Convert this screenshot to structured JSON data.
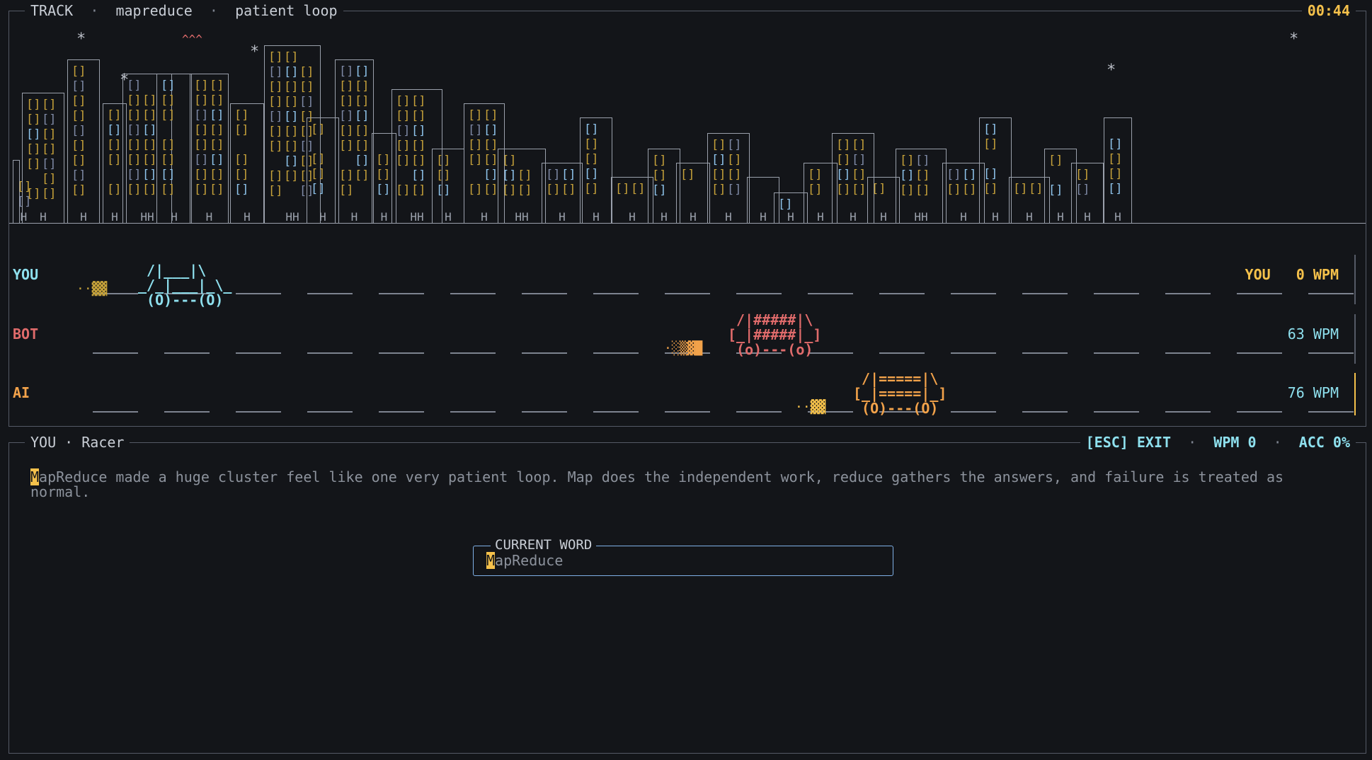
{
  "header": {
    "segments": [
      "TRACK",
      "mapreduce",
      "patient loop"
    ],
    "separator": "·",
    "timer": "00:44"
  },
  "lanes": [
    {
      "name": "YOU",
      "wpm_label": "YOU   0 WPM",
      "color": "#8ee0ee",
      "progress": 0.02
    },
    {
      "name": "BOT",
      "wpm_label": "63 WPM",
      "color": "#e06b6b",
      "progress": 0.45
    },
    {
      "name": "AI",
      "wpm_label": "76 WPM",
      "color": "#f2a24a",
      "progress": 0.54
    }
  ],
  "panel": {
    "title": "YOU · Racer",
    "controls": {
      "exit": "[ESC] EXIT",
      "wpm": "WPM 0",
      "acc": "ACC 0%"
    }
  },
  "passage": {
    "cursor_char": "M",
    "rest": "apReduce made a huge cluster feel like one very patient loop. Map does the independent work, reduce gathers the answers, and failure is treated as normal."
  },
  "current_word": {
    "label": "CURRENT WORD",
    "cursor_char": "M",
    "rest": "apReduce"
  },
  "cars": {
    "you": " /|___|\\\n_/_|___|_\\_\n (O)---(O)",
    "bot": " /|#####|\\\n[_|#####|_]\n (o)---(o)",
    "ai": " /|=====|\\\n[_|=====|_]\n (O)---(O)"
  }
}
